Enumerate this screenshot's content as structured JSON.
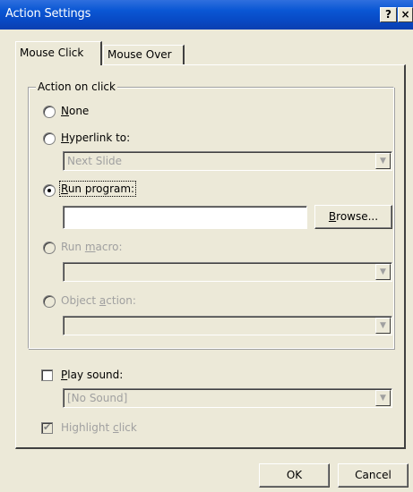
{
  "window": {
    "title": "Action Settings",
    "help_glyph": "?",
    "close_glyph": "×"
  },
  "tabs": [
    {
      "label": "Mouse Click",
      "selected": true
    },
    {
      "label": "Mouse Over",
      "selected": false
    }
  ],
  "action_group": {
    "legend": "Action on click",
    "options": {
      "none": {
        "label_pre": "",
        "accel": "N",
        "label_post": "one",
        "selected": false,
        "enabled": true
      },
      "hyperlink": {
        "label_pre": "",
        "accel": "H",
        "label_post": "yperlink to:",
        "selected": false,
        "enabled": true
      },
      "run_program": {
        "label_pre": "",
        "accel": "R",
        "label_post": "un program:",
        "selected": true,
        "enabled": true
      },
      "run_macro": {
        "label_pre": "Run ",
        "accel": "m",
        "label_post": "acro:",
        "selected": false,
        "enabled": false
      },
      "object_action": {
        "label_pre": "Object ",
        "accel": "a",
        "label_post": "ction:",
        "selected": false,
        "enabled": false
      }
    },
    "hyperlink_value": "Next Slide",
    "program_path": "",
    "browse": {
      "accel": "B",
      "label_post": "rowse..."
    },
    "macro_value": "",
    "object_action_value": ""
  },
  "sound": {
    "label_pre": "",
    "accel": "P",
    "label_post": "lay sound:",
    "checked": false,
    "value": "[No Sound]"
  },
  "highlight": {
    "label_pre": "Highlight ",
    "accel": "c",
    "label_post": "lick",
    "checked": true,
    "enabled": false
  },
  "footer": {
    "ok_label": "OK",
    "cancel_label": "Cancel"
  },
  "colors": {
    "titlebar": "#0a57d4",
    "dialog_bg": "#ece9d8",
    "disabled_text": "#a0a0a0"
  }
}
